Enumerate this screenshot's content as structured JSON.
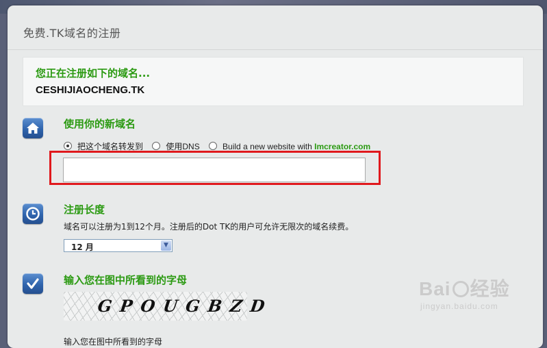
{
  "page": {
    "header_title": "免费.TK域名的注册"
  },
  "domain_box": {
    "notice": "您正在注册如下的域名...",
    "domain": "CESHIJIAOCHENG.TK"
  },
  "section_use": {
    "title": "使用你的新域名",
    "icon": "home-icon",
    "options": [
      {
        "label": "把这个域名转发到",
        "checked": true
      },
      {
        "label": "使用DNS",
        "checked": false
      },
      {
        "label_prefix": "Build a new website with ",
        "label_brand": "Imcreator.com",
        "checked": false
      }
    ],
    "url_input_value": "",
    "highlight_color": "#e0191d"
  },
  "section_length": {
    "title": "注册长度",
    "icon": "clock-icon",
    "description": "域名可以注册为1到12个月。注册后的Dot TK的用户可允许无限次的域名续费。",
    "selected_period": "12 月"
  },
  "section_captcha": {
    "title": "输入您在图中所看到的字母",
    "icon": "checkmark-icon",
    "captcha_text": "GPOUGBZD",
    "instruction": "输入您在图中所看到的字母"
  },
  "watermark": {
    "brand_left": "Bai",
    "brand_right": "经验",
    "sub": "jingyan.baidu.com"
  },
  "colors": {
    "accent_green": "#2b9a12",
    "icon_blue": "#2f64ad",
    "panel_bg": "#e8eaea"
  }
}
